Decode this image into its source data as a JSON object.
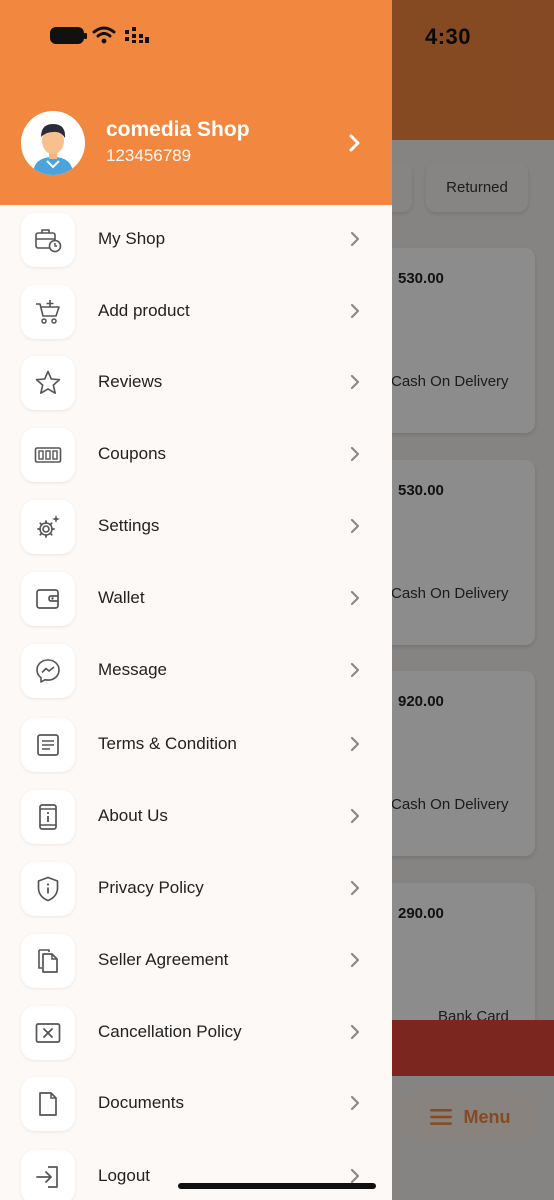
{
  "status_bar": {
    "time": "4:30"
  },
  "background": {
    "tabs": [
      "Returned"
    ],
    "orders": [
      {
        "amount": "530.00",
        "payment": "Cash On Delivery"
      },
      {
        "amount": "530.00",
        "payment": "Cash On Delivery"
      },
      {
        "amount": "920.00",
        "payment": "Cash On Delivery"
      },
      {
        "amount": "290.00",
        "payment": "Bank Card"
      }
    ],
    "menu_button_label": "Menu"
  },
  "drawer": {
    "profile": {
      "name": "comedia Shop",
      "id": "123456789"
    },
    "items": [
      {
        "label": "My Shop",
        "icon": "shop-clock-icon"
      },
      {
        "label": "Add product",
        "icon": "cart-add-icon"
      },
      {
        "label": "Reviews",
        "icon": "star-icon"
      },
      {
        "label": "Coupons",
        "icon": "coupon-icon"
      },
      {
        "label": "Settings",
        "icon": "settings-gear-icon"
      },
      {
        "label": "Wallet",
        "icon": "wallet-icon"
      },
      {
        "label": "Message",
        "icon": "messenger-icon"
      },
      {
        "label": "Terms & Condition",
        "icon": "document-lines-icon"
      },
      {
        "label": "About Us",
        "icon": "info-device-icon"
      },
      {
        "label": "Privacy Policy",
        "icon": "shield-info-icon"
      },
      {
        "label": "Seller Agreement",
        "icon": "copy-files-icon"
      },
      {
        "label": "Cancellation Policy",
        "icon": "cancel-box-icon"
      },
      {
        "label": "Documents",
        "icon": "file-icon"
      },
      {
        "label": "Logout",
        "icon": "logout-icon"
      }
    ]
  },
  "colors": {
    "accent": "#f2873f",
    "drawer_bg": "#fcf9f7",
    "text": "#222222"
  }
}
